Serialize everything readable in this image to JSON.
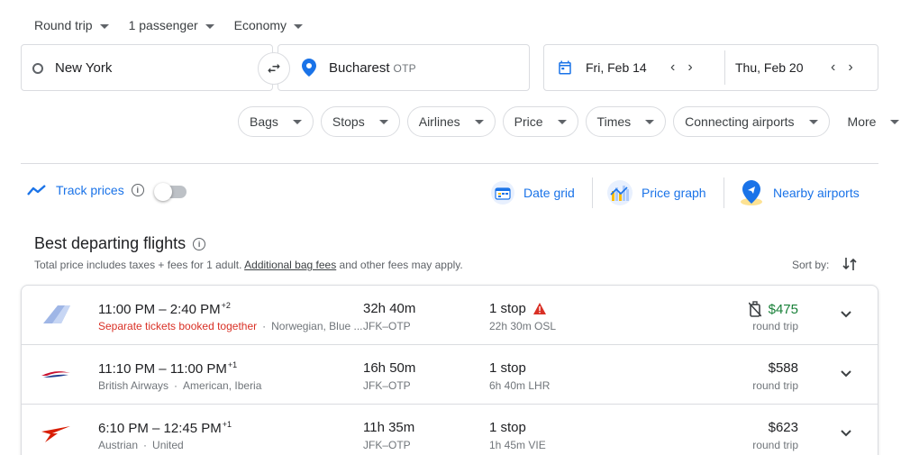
{
  "search": {
    "trip_type": "Round trip",
    "passengers": "1 passenger",
    "cabin": "Economy",
    "origin": "New York",
    "destination": "Bucharest",
    "destination_code": "OTP",
    "depart_date": "Fri, Feb 14",
    "return_date": "Thu, Feb 20"
  },
  "filters": {
    "chips": [
      "Bags",
      "Stops",
      "Airlines",
      "Price",
      "Times",
      "Connecting airports"
    ],
    "more": "More"
  },
  "tools": {
    "track_prices": "Track prices",
    "date_grid": "Date grid",
    "price_graph": "Price graph",
    "nearby_airports": "Nearby airports"
  },
  "results": {
    "title": "Best departing flights",
    "note_prefix": "Total price includes taxes + fees for 1 adult. ",
    "note_link": "Additional bag fees",
    "note_suffix": " and other fees may apply.",
    "sort_label": "Sort by:",
    "flights": [
      {
        "depart_arrive": "11:00 PM – 2:40 PM",
        "day_offset": "+2",
        "warning": "Separate tickets booked together",
        "airlines": "Norwegian, Blue ...",
        "duration": "32h 40m",
        "route": "JFK–OTP",
        "stops": "1 stop",
        "layover": "22h 30m OSL",
        "price": "$475",
        "price_type": "round trip",
        "logo_icon": "norwegian-tail-logo",
        "price_color": "#188038"
      },
      {
        "depart_arrive": "11:10 PM – 11:00 PM",
        "day_offset": "+1",
        "warning": "",
        "airlines": "British Airways · American, Iberia",
        "airline_main": "British Airways",
        "airline_partners": "American, Iberia",
        "duration": "16h 50m",
        "route": "JFK–OTP",
        "stops": "1 stop",
        "layover": "6h 40m LHR",
        "price": "$588",
        "price_type": "round trip",
        "logo_icon": "british-airways-logo"
      },
      {
        "depart_arrive": "6:10 PM – 12:45 PM",
        "day_offset": "+1",
        "warning": "",
        "airline_main": "Austrian",
        "airline_partners": "United",
        "duration": "11h 35m",
        "route": "JFK–OTP",
        "stops": "1 stop",
        "layover": "1h 45m VIE",
        "price": "$623",
        "price_type": "round trip",
        "logo_icon": "austrian-logo"
      }
    ]
  },
  "colors": {
    "accent": "#1a73e8",
    "warning": "#d93025",
    "good_price": "#188038"
  }
}
